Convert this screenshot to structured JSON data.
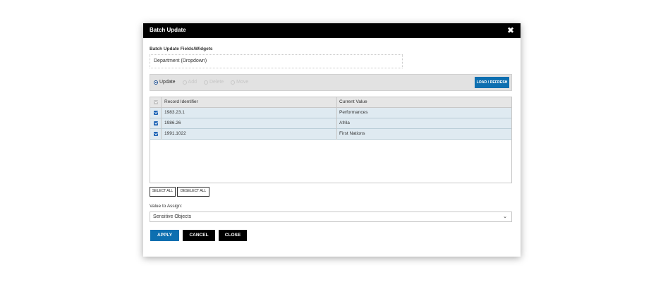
{
  "dialog": {
    "title": "Batch Update",
    "close_icon": "close-icon"
  },
  "fields": {
    "label": "Batch Update Fields/Widgets",
    "selected": "Department (Dropdown)"
  },
  "mode": {
    "options": [
      "Update",
      "Add",
      "Delete",
      "Move"
    ],
    "selected": "Update",
    "load_button": "LOAD / REFRESH"
  },
  "table": {
    "columns": [
      "Record Identifier",
      "Current Value"
    ],
    "rows": [
      {
        "id": "1983.23.1",
        "value": "Performances",
        "checked": true
      },
      {
        "id": "1986.26",
        "value": "Afrila",
        "checked": true
      },
      {
        "id": "1991.1022",
        "value": "First Nations",
        "checked": true
      }
    ]
  },
  "selection": {
    "select_all": "SELECT ALL",
    "deselect_all": "DESELECT ALL"
  },
  "assign": {
    "label": "Value to Assign:",
    "value": "Sensitive Objects"
  },
  "actions": {
    "apply": "APPLY",
    "cancel": "CANCEL",
    "close": "CLOSE"
  },
  "colors": {
    "primary": "#0d6fb0",
    "titlebar": "#000000",
    "row_highlight": "#dfeaf1"
  }
}
